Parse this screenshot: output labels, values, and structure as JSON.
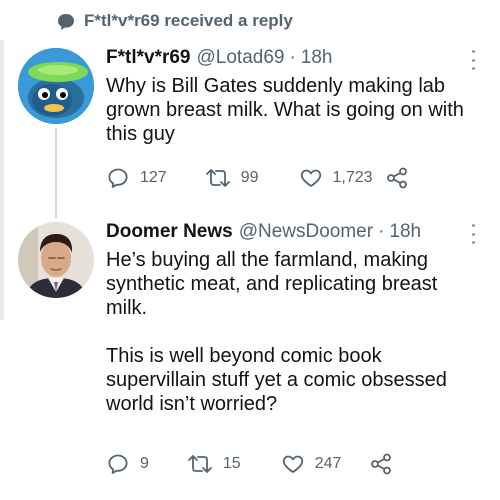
{
  "context": {
    "text": "F*tl*v*r69 received a reply",
    "icon": "chat-bubble-icon"
  },
  "tweets": [
    {
      "name": "F*tl*v*r69",
      "handle": "@Lotad69",
      "dot": "·",
      "time": "18h",
      "text": "Why is Bill Gates suddenly making  lab grown breast milk. What is going on with this guy",
      "replies": "127",
      "retweets": "99",
      "likes": "1,723",
      "avatar": "frog-avatar-icon"
    },
    {
      "name": "Doomer News",
      "handle": "@NewsDoomer",
      "dot": "·",
      "time": "18h",
      "text": "He’s buying all the farmland, making synthetic meat, and replicating breast milk.\n\nThis is well beyond comic book supervillain stuff yet a comic obsessed world isn’t worried?",
      "replies": "9",
      "retweets": "15",
      "likes": "247",
      "avatar": "man-portrait-avatar-icon"
    }
  ],
  "colors": {
    "text": "#0f1419",
    "secondary": "#536471",
    "line": "#cfd9de",
    "accent": "#1d9bf0"
  }
}
